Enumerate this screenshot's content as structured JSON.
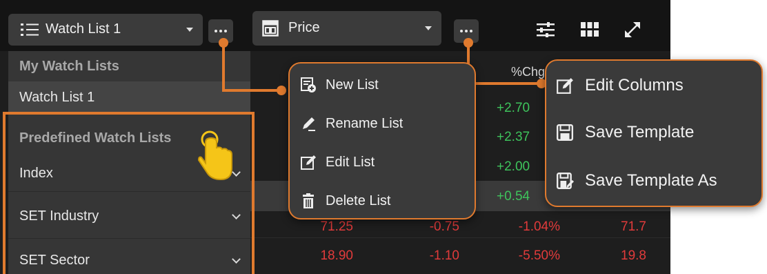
{
  "watchlist_select": {
    "label": "Watch List 1"
  },
  "price_select": {
    "label": "Price"
  },
  "dropdown": {
    "my_lists_header": "My Watch Lists",
    "my_lists": [
      "Watch List 1"
    ],
    "predefined_header": "Predefined Watch Lists",
    "predefined": [
      {
        "label": "Index"
      },
      {
        "label": "SET Industry"
      },
      {
        "label": "SET Sector"
      }
    ]
  },
  "list_menu": {
    "items": [
      {
        "label": "New List",
        "icon": "new-list-icon"
      },
      {
        "label": "Rename List",
        "icon": "pencil-icon"
      },
      {
        "label": "Edit List",
        "icon": "edit-icon"
      },
      {
        "label": "Delete List",
        "icon": "trash-icon"
      }
    ]
  },
  "column_menu": {
    "items": [
      {
        "label": "Edit Columns",
        "icon": "edit-icon"
      },
      {
        "label": "Save Template",
        "icon": "save-icon"
      },
      {
        "label": "Save Template As",
        "icon": "save-as-icon"
      }
    ]
  },
  "table": {
    "pct_header": "%Chg",
    "partial_green": [
      "+2.70",
      "+2.37",
      "+2.00",
      "+0.54"
    ],
    "rows": [
      {
        "last": "71.25",
        "chg": "-0.75",
        "pct": "-1.04%",
        "prev": "71.7"
      },
      {
        "last": "18.90",
        "chg": "-1.10",
        "pct": "-5.50%",
        "prev": "19.8"
      }
    ]
  },
  "colors": {
    "accent": "#e07a2e",
    "up": "#3ec45c",
    "down": "#e23b3b"
  }
}
